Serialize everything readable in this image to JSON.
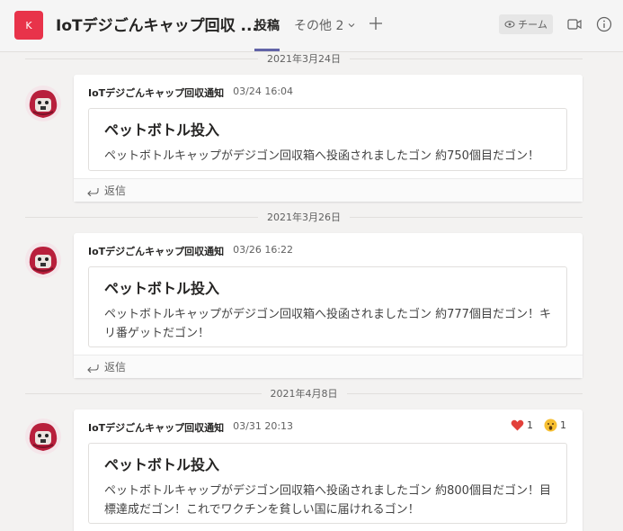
{
  "header": {
    "avatar_letter": "K",
    "avatar_color": "#e8334a",
    "title": "IoTデジごんキャップ回収 ...",
    "tabs": [
      {
        "label": "投稿",
        "active": true
      },
      {
        "label": "その他 2",
        "active": false
      }
    ],
    "team_button_label": "チーム",
    "icons": [
      "add-tab-icon",
      "eye-icon",
      "meet-icon",
      "info-icon"
    ]
  },
  "accent_color": "#6264a7",
  "messages": [
    {
      "date_label": "2021年3月24日",
      "sender": "IoTデジごんキャップ回収通知",
      "time": "03/24 16:04",
      "card_title": "ペットボトル投入",
      "card_body": "ペットボトルキャップがデジゴン回収箱へ投函されましたゴン 約750個目だゴン！",
      "reply_label": "返信"
    },
    {
      "date_label": "2021年3月26日",
      "sender": "IoTデジごんキャップ回収通知",
      "time": "03/26 16:22",
      "card_title": "ペットボトル投入",
      "card_body": "ペットボトルキャップがデジゴン回収箱へ投函されましたゴン 約777個目だゴン！キリ番ゲットだゴン！",
      "reply_label": "返信"
    },
    {
      "date_label": "2021年4月8日",
      "sender": "IoTデジごんキャップ回収通知",
      "time": "03/31 20:13",
      "card_title": "ペットボトル投入",
      "card_body": "ペットボトルキャップがデジゴン回収箱へ投函されましたゴン 約800個目だゴン！目標達成だゴン！これでワクチンを貧しい国に届けれるゴン！",
      "reactions": [
        {
          "icon": "heart-icon",
          "count": "1"
        },
        {
          "icon": "surprised-face-icon",
          "count": "1"
        }
      ]
    }
  ]
}
